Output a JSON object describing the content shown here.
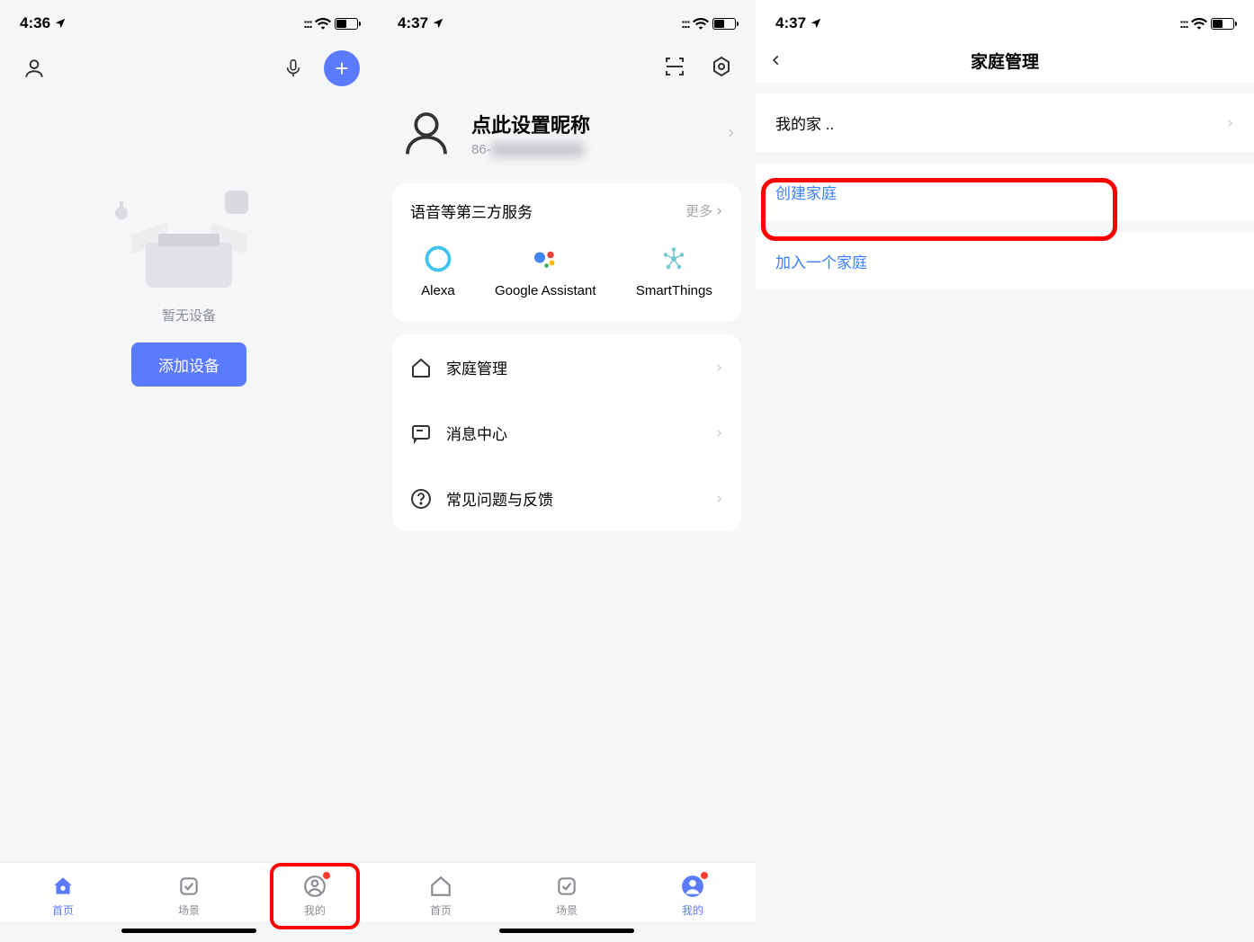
{
  "screen1": {
    "status_time": "4:36",
    "empty_text": "暂无设备",
    "add_button": "添加设备",
    "tabs": {
      "home": "首页",
      "scene": "场景",
      "mine": "我的"
    }
  },
  "screen2": {
    "status_time": "4:37",
    "profile": {
      "name": "点此设置昵称",
      "sub_prefix": "86-"
    },
    "services": {
      "title": "语音等第三方服务",
      "more": "更多",
      "items": [
        "Alexa",
        "Google Assistant",
        "SmartThings"
      ]
    },
    "menu": {
      "home_manage": "家庭管理",
      "message_center": "消息中心",
      "faq_feedback": "常见问题与反馈"
    },
    "tabs": {
      "home": "首页",
      "scene": "场景",
      "mine": "我的"
    }
  },
  "screen3": {
    "status_time": "4:37",
    "title": "家庭管理",
    "my_home": "我的家 ..",
    "create_home": "创建家庭",
    "join_home": "加入一个家庭"
  }
}
